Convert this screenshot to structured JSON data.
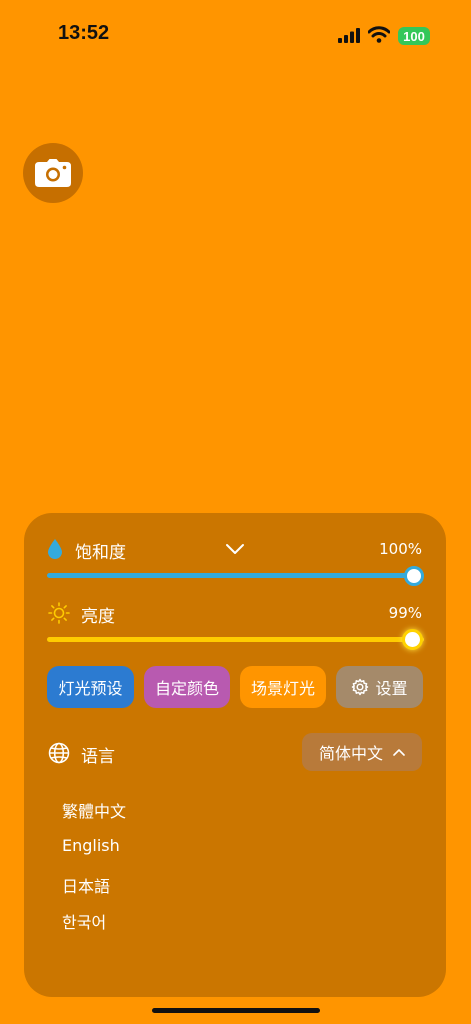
{
  "status": {
    "time": "13:52",
    "battery": "100"
  },
  "camera": {
    "icon": "camera-icon"
  },
  "saturation": {
    "label": "饱和度",
    "value": "100%",
    "level": 1.0,
    "color": "#34aadc"
  },
  "brightness": {
    "label": "亮度",
    "value": "99%",
    "level": 0.99,
    "color": "#ffcc00"
  },
  "buttons": {
    "presets": "灯光预设",
    "custom_color": "自定颜色",
    "scene": "场景灯光",
    "settings": "设置"
  },
  "language": {
    "label": "语言",
    "selected": "简体中文",
    "options": [
      "繁體中文",
      "English",
      "日本語",
      "한국어"
    ]
  }
}
